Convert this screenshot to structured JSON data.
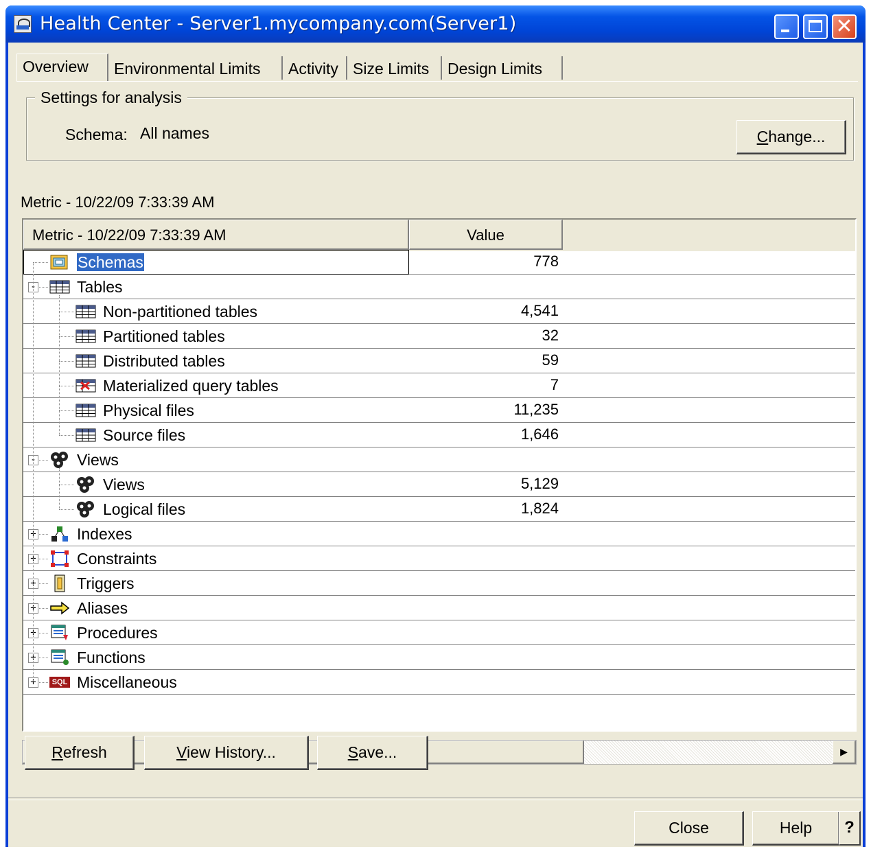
{
  "window": {
    "title": "Health Center - Server1.mycompany.com(Server1)",
    "close_glyph": "✕"
  },
  "tabs": [
    {
      "label": "Overview",
      "active": true
    },
    {
      "label": "Environmental Limits",
      "active": false
    },
    {
      "label": "Activity",
      "active": false
    },
    {
      "label": "Size Limits",
      "active": false
    },
    {
      "label": "Design Limits",
      "active": false
    }
  ],
  "settings": {
    "legend": "Settings for analysis",
    "schema_label": "Schema:",
    "schema_value": "All names",
    "change_button": "Change..."
  },
  "metric_caption": "Metric - 10/22/09 7:33:39 AM",
  "table": {
    "columns": [
      "Metric - 10/22/09 7:33:39 AM",
      "Value"
    ],
    "rows": [
      {
        "label": "Schemas",
        "value": "778",
        "level": 0,
        "icon": "schema-icon",
        "selected": true
      },
      {
        "label": "Tables",
        "value": "",
        "level": 0,
        "icon": "table-icon",
        "expander": "-"
      },
      {
        "label": "Non-partitioned tables",
        "value": "4,541",
        "level": 1,
        "icon": "table-icon"
      },
      {
        "label": "Partitioned tables",
        "value": "32",
        "level": 1,
        "icon": "table-icon"
      },
      {
        "label": "Distributed tables",
        "value": "59",
        "level": 1,
        "icon": "table-icon"
      },
      {
        "label": "Materialized query tables",
        "value": "7",
        "level": 1,
        "icon": "mqt-icon"
      },
      {
        "label": "Physical files",
        "value": "11,235",
        "level": 1,
        "icon": "table-icon"
      },
      {
        "label": "Source files",
        "value": "1,646",
        "level": 1,
        "icon": "table-icon"
      },
      {
        "label": "Views",
        "value": "",
        "level": 0,
        "icon": "view-icon",
        "expander": "-"
      },
      {
        "label": "Views",
        "value": "5,129",
        "level": 1,
        "icon": "view-icon"
      },
      {
        "label": "Logical files",
        "value": "1,824",
        "level": 1,
        "icon": "view-icon"
      },
      {
        "label": "Indexes",
        "value": "",
        "level": 0,
        "icon": "index-icon",
        "expander": "+"
      },
      {
        "label": "Constraints",
        "value": "",
        "level": 0,
        "icon": "constraint-icon",
        "expander": "+"
      },
      {
        "label": "Triggers",
        "value": "",
        "level": 0,
        "icon": "trigger-icon",
        "expander": "+"
      },
      {
        "label": "Aliases",
        "value": "",
        "level": 0,
        "icon": "alias-icon",
        "expander": "+"
      },
      {
        "label": "Procedures",
        "value": "",
        "level": 0,
        "icon": "procedure-icon",
        "expander": "+"
      },
      {
        "label": "Functions",
        "value": "",
        "level": 0,
        "icon": "function-icon",
        "expander": "+"
      },
      {
        "label": "Miscellaneous",
        "value": "",
        "level": 0,
        "icon": "sql-icon",
        "icon_text": "SQL",
        "expander": "+"
      }
    ]
  },
  "scrollbar": {
    "left_arrow": "◀",
    "right_arrow": "▶"
  },
  "buttons": {
    "refresh": "Refresh",
    "view_history": "View History...",
    "save": "Save...",
    "close": "Close",
    "help": "Help",
    "help_q": "?"
  },
  "colors": {
    "titlebar": "#0454e6",
    "selection": "#316ac5",
    "dialog_bg": "#ece9d8"
  }
}
